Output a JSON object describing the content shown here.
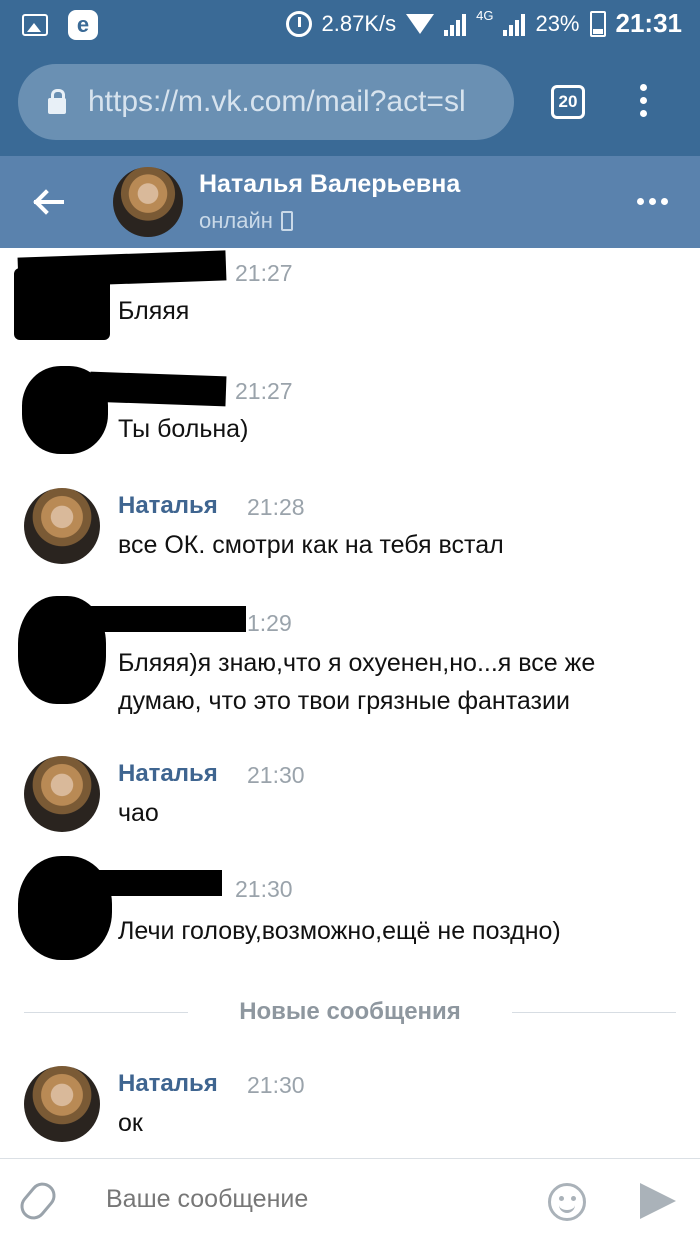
{
  "status_bar": {
    "speed": "2.87K/s",
    "network": "4G",
    "battery": "23%",
    "time": "21:31"
  },
  "browser": {
    "url": "https://m.vk.com/mail?act=sl",
    "tabs_count": "20"
  },
  "header": {
    "name": "Наталья Валерьевна",
    "status": "онлайн"
  },
  "messages": [
    {
      "sender": "",
      "time": "21:27",
      "text": "Бляяя",
      "redacted": true
    },
    {
      "sender": "",
      "time": "21:27",
      "text": "Ты больна)",
      "redacted": true
    },
    {
      "sender": "Наталья",
      "time": "21:28",
      "text": "все ОК. смотри как на тебя встал",
      "redacted": false
    },
    {
      "sender": "",
      "time": "1:29",
      "text_lines": [
        "Бляяя)я знаю,что я охуенен,но...я все же",
        "думаю, что это твои грязные фантазии"
      ],
      "redacted": true
    },
    {
      "sender": "Наталья",
      "time": "21:30",
      "text": "чао",
      "redacted": false
    },
    {
      "sender": "",
      "time": "21:30",
      "text": "Лечи голову,возможно,ещё не поздно)",
      "redacted": true
    },
    {
      "sender": "Наталья",
      "time": "21:30",
      "text": "ок",
      "redacted": false
    }
  ],
  "divider": {
    "label": "Новые сообщения"
  },
  "composer": {
    "placeholder": "Ваше сообщение"
  },
  "icons": {
    "gallery": "image-icon",
    "browser_e": "e-icon",
    "alarm": "alarm-icon",
    "wifi": "wifi-icon",
    "signal": "signal-icon",
    "battery": "battery-icon",
    "lock": "lock-icon",
    "back": "back-arrow-icon",
    "menu": "more-icon",
    "phone": "phone-icon",
    "attach": "paperclip-icon",
    "emoji": "emoji-icon",
    "send": "send-icon"
  },
  "colors": {
    "header_blue": "#5a82ad",
    "status_blue": "#3a6a96",
    "name_blue": "#3f6590"
  }
}
